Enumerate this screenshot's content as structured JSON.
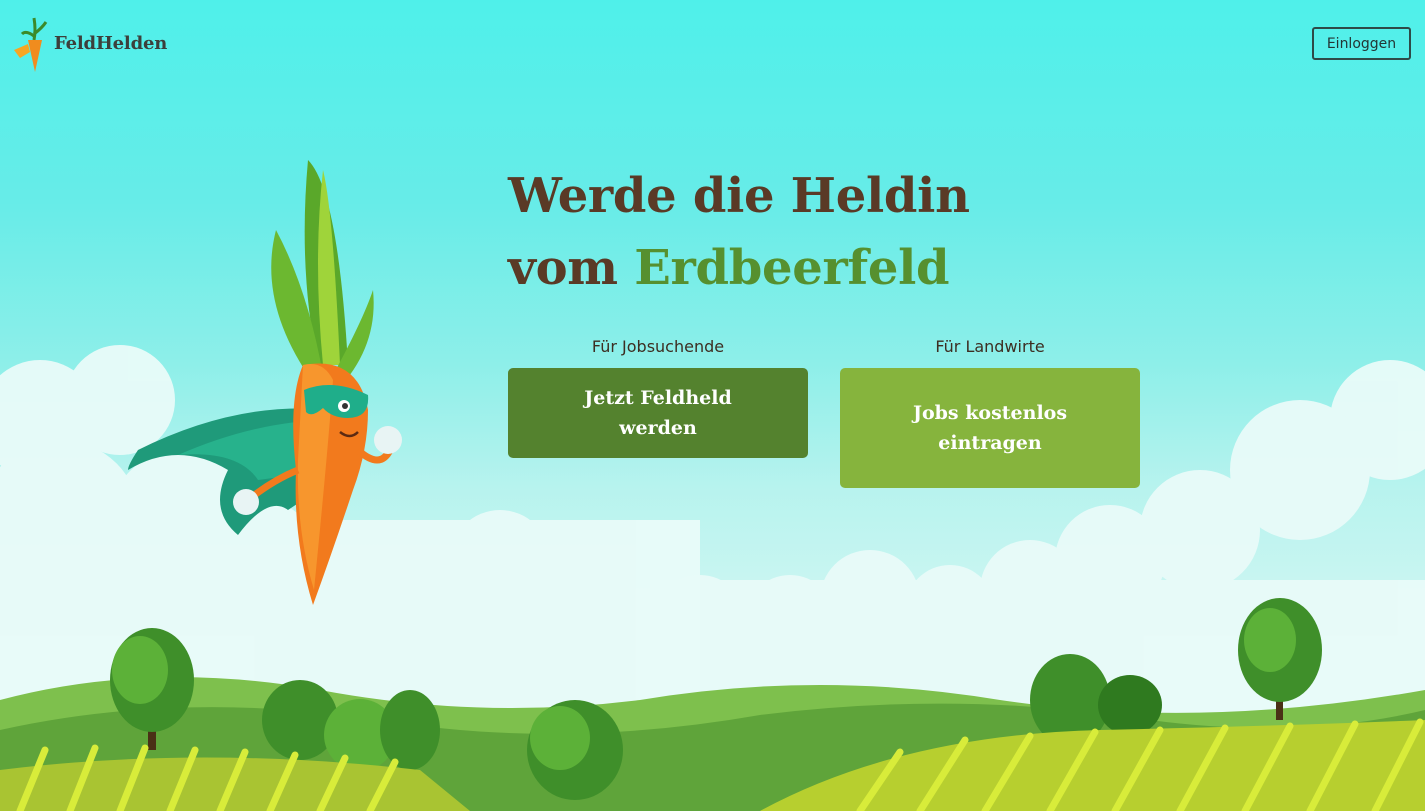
{
  "brand": {
    "name": "FeldHelden",
    "icon": "carrot-logo-icon"
  },
  "header": {
    "login_label": "Einloggen"
  },
  "hero": {
    "line1": "Werde die Heldin",
    "line2_prefix": "vom ",
    "line2_accent": "Erdbeerfeld",
    "mascot": "superhero-carrot-illustration"
  },
  "ctas": [
    {
      "audience": "Für Jobsuchende",
      "label": "Jetzt Feldheld werden"
    },
    {
      "audience": "Für Landwirte",
      "label": "Jobs kostenlos eintragen"
    }
  ],
  "colors": {
    "brown_text": "#5a3a26",
    "accent_green": "#56902f",
    "button_dark": "#54822e",
    "button_light": "#86b43d",
    "sky": "#4ff0ea"
  }
}
